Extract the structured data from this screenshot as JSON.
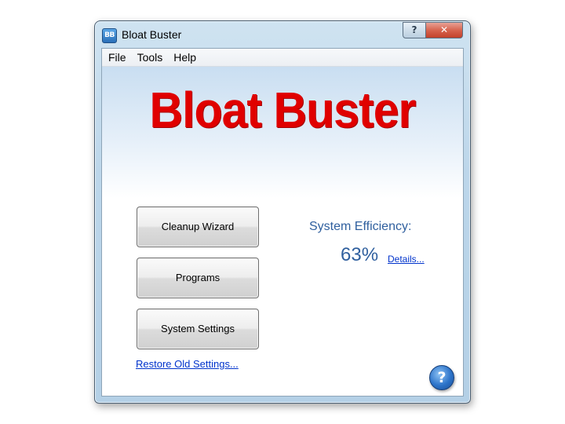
{
  "window": {
    "title": "Bloat Buster",
    "app_icon_text": "BB",
    "help_button": "?",
    "close_button": "✕"
  },
  "menu": {
    "items": [
      "File",
      "Tools",
      "Help"
    ]
  },
  "logo": {
    "text": "Bloat Buster",
    "color": "#e00000"
  },
  "buttons": {
    "cleanup_wizard": "Cleanup Wizard",
    "programs": "Programs",
    "system_settings": "System Settings"
  },
  "links": {
    "restore": "Restore Old Settings...",
    "details": "Details..."
  },
  "efficiency": {
    "label": "System Efficiency:",
    "value": "63%"
  },
  "help_icon": {
    "glyph": "?",
    "icon": "help-icon"
  },
  "colors": {
    "accent_text": "#2f5f9e",
    "link": "#0033cc",
    "close": "#c2402a"
  }
}
